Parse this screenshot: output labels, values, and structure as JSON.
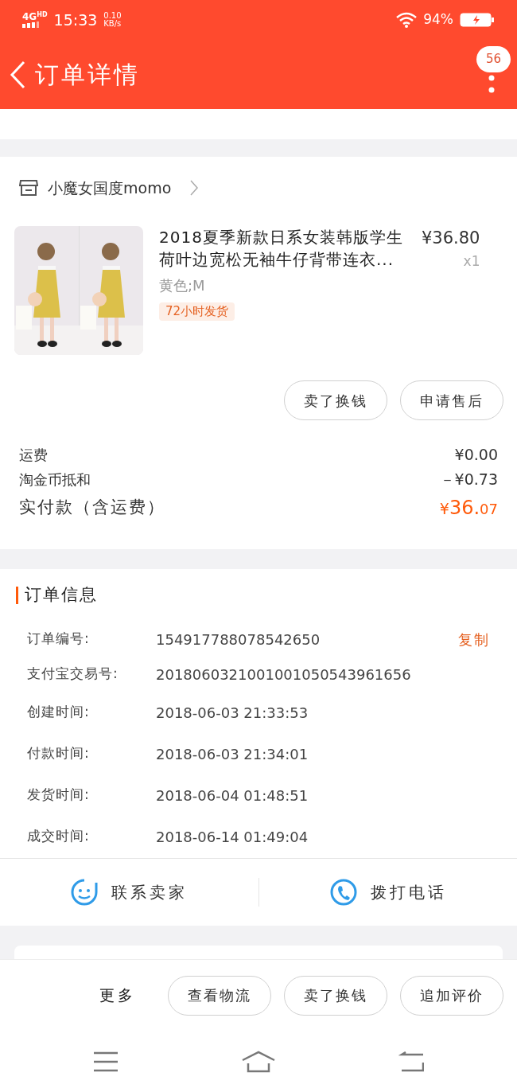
{
  "status_bar": {
    "network": "4G",
    "network_sup": "HD",
    "time": "15:33",
    "speed": "0.10",
    "speed_unit": "KB/s",
    "battery": "94%"
  },
  "header": {
    "title": "订单详情",
    "badge": "56"
  },
  "shop": {
    "name": "小魔女国度momo"
  },
  "item": {
    "title": "2018夏季新款日系女装韩版学生荷叶边宽松无袖牛仔背带连衣...",
    "price": "¥36.80",
    "qty": "x1",
    "sku": "黄色;M",
    "tag": "72小时发货"
  },
  "item_buttons": [
    "卖了换钱",
    "申请售后"
  ],
  "costs": [
    {
      "label": "运费",
      "value": "¥0.00"
    },
    {
      "label": "淘金币抵和",
      "value": "－¥0.73"
    }
  ],
  "total": {
    "label": "实付款（含运费）",
    "currency": "¥",
    "main": "36.",
    "cents": "07"
  },
  "order_info": {
    "title": "订单信息",
    "rows": [
      {
        "label": "订单编号:",
        "value": "154917788078542650",
        "action": "复制"
      },
      {
        "label": "支付宝交易号:",
        "value": "2018060321001001050543961656"
      },
      {
        "label": "创建时间:",
        "value": "2018-06-03 21:33:53"
      },
      {
        "label": "付款时间:",
        "value": "2018-06-03 21:34:01"
      },
      {
        "label": "发货时间:",
        "value": "2018-06-04 01:48:51"
      },
      {
        "label": "成交时间:",
        "value": "2018-06-14 01:49:04"
      }
    ]
  },
  "contact": [
    {
      "kind": "chat",
      "label": "联系卖家"
    },
    {
      "kind": "phone",
      "label": "拨打电话"
    }
  ],
  "bottom_bar": {
    "more": "更多",
    "buttons": [
      "查看物流",
      "卖了换钱",
      "追加评价"
    ]
  }
}
